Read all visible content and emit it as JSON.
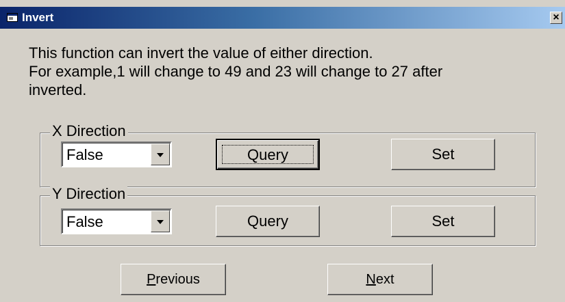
{
  "window": {
    "title": "Invert",
    "close_glyph": "×",
    "icon": "app-window-icon"
  },
  "description": {
    "line1": "This function can invert the value of either direction.",
    "line2": "For example,1 will change to 49 and 23 will change to 27 after",
    "line3": "inverted."
  },
  "x_direction": {
    "legend": "X Direction",
    "select_value": "False",
    "query_label": "Query",
    "set_label": "Set"
  },
  "y_direction": {
    "legend": "Y Direction",
    "select_value": "False",
    "query_label": "Query",
    "set_label": "Set"
  },
  "nav": {
    "previous_mnemonic": "P",
    "previous_rest": "revious",
    "next_mnemonic": "N",
    "next_rest": "ext"
  },
  "colors": {
    "title_gradient_start": "#0a246a",
    "title_gradient_end": "#a6caf0",
    "dialog_face": "#d4d0c8"
  }
}
